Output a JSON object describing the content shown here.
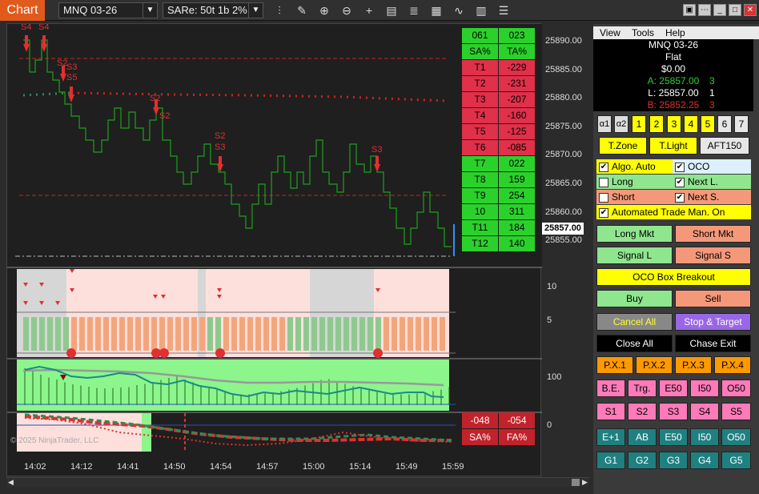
{
  "app": {
    "tab_label": "Chart"
  },
  "toolbar": {
    "instrument": "MNQ 03-26",
    "bar_type": "SARe: 50t 1b 2%",
    "tools": [
      "bar-type-icon",
      "draw-pencil-icon",
      "zoom-in-icon",
      "zoom-out-icon",
      "crosshair-icon",
      "data-box-icon",
      "strategy-icon",
      "indicator-icon",
      "properties-icon",
      "templates-icon"
    ]
  },
  "price_axis": [
    "25890.00",
    "25885.00",
    "25880.00",
    "25875.00",
    "25870.00",
    "25865.00",
    "25860.00",
    "25855.00"
  ],
  "current_price": "25857.00",
  "indicator_axis": [
    "10",
    "5",
    "100",
    "0"
  ],
  "time_axis": [
    "14:02",
    "14:12",
    "14:41",
    "14:50",
    "14:54",
    "14:57",
    "15:00",
    "15:14",
    "15:49",
    "15:59"
  ],
  "watermark": "© 2025 NinjaTrader, LLC",
  "signal_labels": [
    "S4",
    "S4",
    "S2",
    "S3",
    "S5",
    "S2",
    "S2",
    "S2",
    "S3",
    "S3"
  ],
  "stats_table": {
    "header": [
      "061",
      "023"
    ],
    "subheader": [
      "SA%",
      "TA%"
    ],
    "rows": [
      {
        "label": "T1",
        "value": "-229",
        "color": "r"
      },
      {
        "label": "T2",
        "value": "-231",
        "color": "r"
      },
      {
        "label": "T3",
        "value": "-207",
        "color": "r"
      },
      {
        "label": "T4",
        "value": "-160",
        "color": "r"
      },
      {
        "label": "T5",
        "value": "-125",
        "color": "r"
      },
      {
        "label": "T6",
        "value": "-085",
        "color": "r"
      },
      {
        "label": "T7",
        "value": "022",
        "color": "g"
      },
      {
        "label": "T8",
        "value": "159",
        "color": "g"
      },
      {
        "label": "T9",
        "value": "254",
        "color": "g"
      },
      {
        "label": "10",
        "value": "311",
        "color": "g"
      },
      {
        "label": "T11",
        "value": "184",
        "color": "g"
      },
      {
        "label": "T12",
        "value": "140",
        "color": "g"
      }
    ]
  },
  "bottom_table": {
    "row1": [
      "-048",
      "-054"
    ],
    "row2": [
      "SA%",
      "FA%"
    ]
  },
  "panel": {
    "menu": [
      "View",
      "Tools",
      "Help"
    ],
    "instrument": "MNQ 03-26",
    "position": "Flat",
    "pnl": "$0.00",
    "ask_label": "A: 25857.00",
    "ask_size": "3",
    "last_label": "L: 25857.00",
    "last_size": "1",
    "bid_label": "B: 25852.25",
    "bid_size": "3",
    "tabs": [
      "α1",
      "α2",
      "1",
      "2",
      "3",
      "4",
      "5",
      "6",
      "7"
    ],
    "modes": [
      "T.Zone",
      "T.Light",
      "AFT150"
    ],
    "checks": {
      "algo_auto": "Algo. Auto",
      "oco": "OCO",
      "long": "Long",
      "next_l": "Next L.",
      "short": "Short",
      "next_s": "Next S.",
      "atm": "Automated Trade Man. On"
    },
    "buttons": {
      "long_mkt": "Long Mkt",
      "short_mkt": "Short Mkt",
      "signal_l": "Signal L",
      "signal_s": "Signal S",
      "oco_box": "OCO Box Breakout",
      "buy": "Buy",
      "sell": "Sell",
      "cancel_all": "Cancel All",
      "stop_target": "Stop & Target",
      "close_all": "Close All",
      "chase_exit": "Chase Exit"
    },
    "px_buttons": [
      "P.X.1",
      "P.X.2",
      "P.X.3",
      "P.X.4"
    ],
    "row_e": [
      "B.E.",
      "Trg.",
      "E50",
      "I50",
      "O50"
    ],
    "row_s": [
      "S1",
      "S2",
      "S3",
      "S4",
      "S5"
    ],
    "row_t": [
      "E+1",
      "AB",
      "E50",
      "I50",
      "O50"
    ],
    "row_g": [
      "G1",
      "G2",
      "G3",
      "G4",
      "G5"
    ]
  }
}
